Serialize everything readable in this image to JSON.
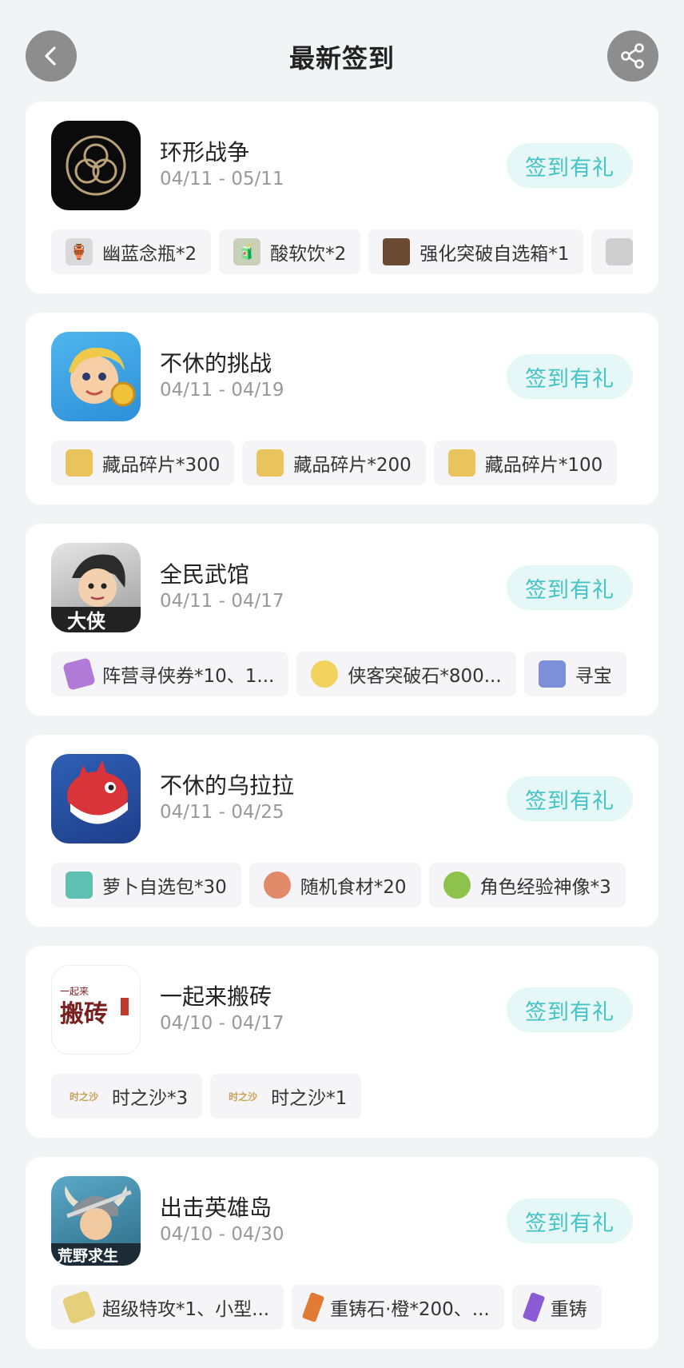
{
  "header": {
    "title": "最新签到",
    "back_icon": "chevron-left-icon",
    "share_icon": "share-icon"
  },
  "colors": {
    "background": "#f2f3f5",
    "accent": "#44c2c4",
    "accent_bg": "#e6f7f7",
    "header_button": "#8d8d8d"
  },
  "games": [
    {
      "name": "环形战争",
      "date": "04/11 - 05/11",
      "button": "签到有礼",
      "rewards": [
        {
          "label": "幽蓝念瓶*2",
          "icon": "bottle-icon"
        },
        {
          "label": "酸软饮*2",
          "icon": "drink-icon"
        },
        {
          "label": "强化突破自选箱*1",
          "icon": "chest-icon"
        },
        {
          "label": "",
          "icon": "item-icon"
        }
      ]
    },
    {
      "name": "不休的挑战",
      "date": "04/11 - 04/19",
      "button": "签到有礼",
      "rewards": [
        {
          "label": "藏品碎片*300",
          "icon": "fragment-icon"
        },
        {
          "label": "藏品碎片*200",
          "icon": "fragment-icon"
        },
        {
          "label": "藏品碎片*100",
          "icon": "fragment-icon"
        }
      ]
    },
    {
      "name": "全民武馆",
      "date": "04/11 - 04/17",
      "button": "签到有礼",
      "rewards": [
        {
          "label": "阵营寻侠券*10、1...",
          "icon": "ticket-icon"
        },
        {
          "label": "侠客突破石*800...",
          "icon": "stone-icon"
        },
        {
          "label": "寻宝",
          "icon": "treasure-icon"
        }
      ]
    },
    {
      "name": "不休的乌拉拉",
      "date": "04/11 - 04/25",
      "button": "签到有礼",
      "rewards": [
        {
          "label": "萝卜自选包*30",
          "icon": "carrot-pack-icon"
        },
        {
          "label": "随机食材*20",
          "icon": "meat-icon"
        },
        {
          "label": "角色经验神像*3",
          "icon": "statue-icon"
        }
      ]
    },
    {
      "name": "一起来搬砖",
      "date": "04/10 - 04/17",
      "button": "签到有礼",
      "rewards": [
        {
          "label": "时之沙*3",
          "icon": "sand-icon",
          "icon_text": "时之沙"
        },
        {
          "label": "时之沙*1",
          "icon": "sand-icon",
          "icon_text": "时之沙"
        }
      ]
    },
    {
      "name": "出击英雄岛",
      "date": "04/10 - 04/30",
      "button": "签到有礼",
      "rewards": [
        {
          "label": "超级特攻*1、小型...",
          "icon": "scroll-icon"
        },
        {
          "label": "重铸石·橙*200、...",
          "icon": "orange-crystal-icon"
        },
        {
          "label": "重铸",
          "icon": "purple-crystal-icon"
        }
      ]
    }
  ]
}
